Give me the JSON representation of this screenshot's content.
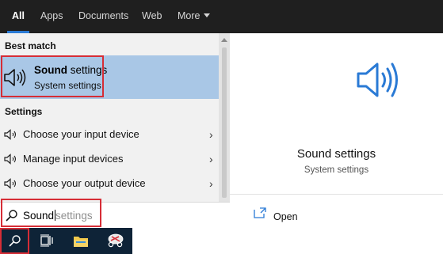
{
  "tabs": [
    {
      "label": "All",
      "active": true
    },
    {
      "label": "Apps"
    },
    {
      "label": "Documents"
    },
    {
      "label": "Web"
    },
    {
      "label": "More",
      "icon": "caret-down-icon"
    }
  ],
  "left_panel": {
    "best_match_heading": "Best match",
    "best_match": {
      "title_bold": "Sound",
      "title_rest": " settings",
      "subtitle": "System settings",
      "icon": "speaker-icon"
    },
    "settings_heading": "Settings",
    "settings_items": [
      {
        "label": "Choose your input device",
        "icon": "speaker-icon"
      },
      {
        "label": "Manage input devices",
        "icon": "speaker-icon"
      },
      {
        "label": "Choose your output device",
        "icon": "speaker-icon"
      }
    ]
  },
  "preview": {
    "title": "Sound settings",
    "subtitle": "System settings",
    "icon": "speaker-icon",
    "actions": [
      {
        "label": "Open",
        "icon": "open-icon"
      }
    ]
  },
  "search": {
    "typed": "Sound",
    "suggestion": "settings",
    "icon": "search-icon"
  },
  "taskbar": {
    "items": [
      "search-icon",
      "task-view-icon",
      "file-explorer-icon",
      "snipping-tool-icon"
    ],
    "background": "#0e2337"
  },
  "colors": {
    "highlight": "#a9c7e6",
    "annotation_red": "#d62d36",
    "icon_blue": "#2a7ad5",
    "topbar": "#1f1f1f"
  }
}
